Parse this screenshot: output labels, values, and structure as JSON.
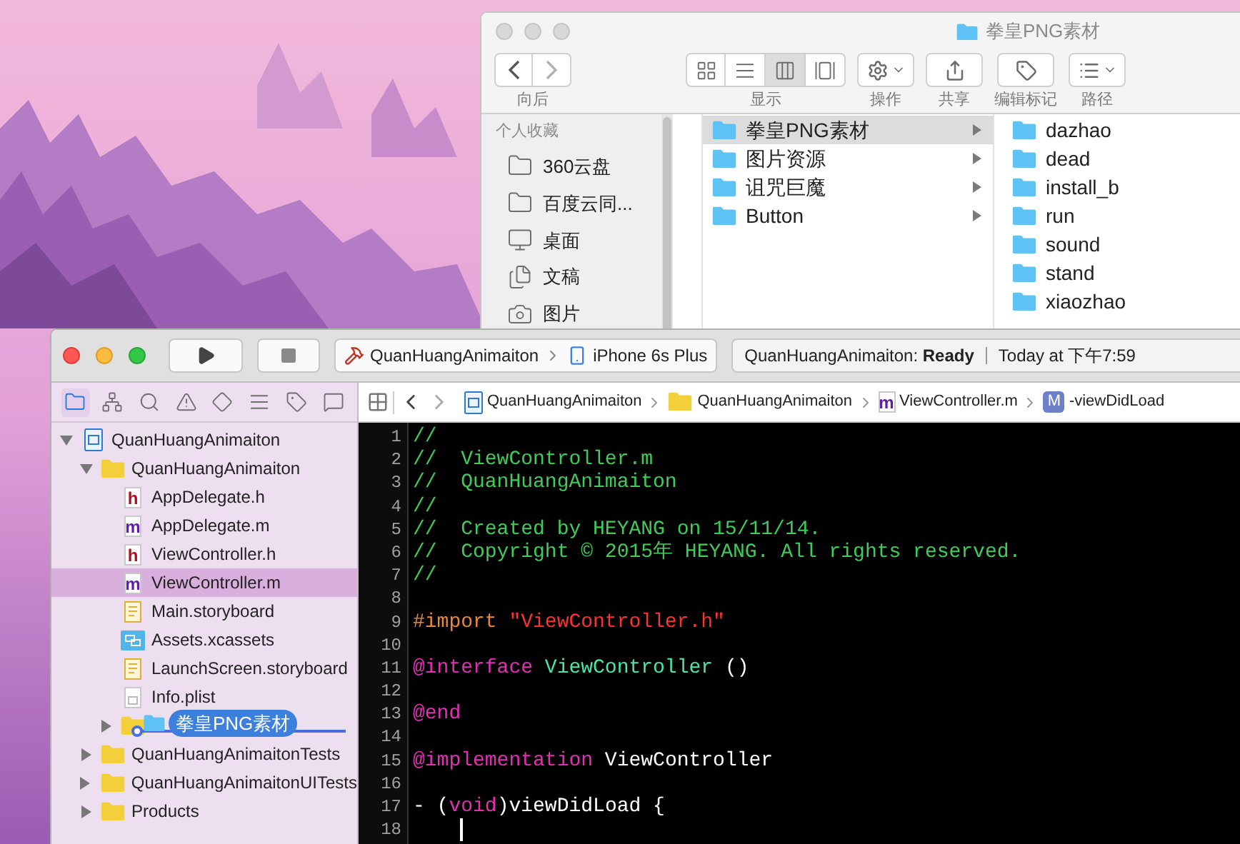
{
  "finder": {
    "title": "拳皇PNG素材",
    "toolbar": [
      {
        "label": "向后",
        "kind": "nav"
      },
      {
        "label": "显示",
        "kind": "view"
      },
      {
        "label": "操作",
        "kind": "action"
      },
      {
        "label": "共享",
        "kind": "share"
      },
      {
        "label": "编辑标记",
        "kind": "tag"
      },
      {
        "label": "路径",
        "kind": "path"
      }
    ],
    "view_modes": [
      {
        "kind": "icons",
        "selected": false
      },
      {
        "kind": "list",
        "selected": false
      },
      {
        "kind": "columns",
        "selected": true
      },
      {
        "kind": "coverflow",
        "selected": false
      }
    ],
    "sidebar": {
      "heading": "个人收藏",
      "items": [
        {
          "label": "360云盘",
          "kind": "folder"
        },
        {
          "label": "百度云同...",
          "kind": "folder"
        },
        {
          "label": "桌面",
          "kind": "desktop"
        },
        {
          "label": "文稿",
          "kind": "document"
        },
        {
          "label": "图片",
          "kind": "camera"
        }
      ]
    },
    "columns": [
      {
        "items": [
          {
            "label": "拳皇PNG素材",
            "selected": true,
            "expandable": true
          },
          {
            "label": "图片资源",
            "selected": false,
            "expandable": true
          },
          {
            "label": "诅咒巨魔",
            "selected": false,
            "expandable": true
          },
          {
            "label": "Button",
            "selected": false,
            "expandable": true
          }
        ]
      },
      {
        "items": [
          {
            "label": "dazhao",
            "selected": false,
            "expandable": false
          },
          {
            "label": "dead",
            "selected": false,
            "expandable": false
          },
          {
            "label": "install_b",
            "selected": false,
            "expandable": false
          },
          {
            "label": "run",
            "selected": false,
            "expandable": false
          },
          {
            "label": "sound",
            "selected": false,
            "expandable": false
          },
          {
            "label": "stand",
            "selected": false,
            "expandable": false
          },
          {
            "label": "xiaozhao",
            "selected": false,
            "expandable": false
          }
        ]
      }
    ]
  },
  "xcode": {
    "scheme": "QuanHuangAnimaiton",
    "device": "iPhone 6s Plus",
    "status": "QuanHuangAnimaiton: **Ready**",
    "time": "Today at 下午7:59",
    "navigator_tabs": [
      {
        "kind": "folder",
        "selected": true
      },
      {
        "kind": "hierarchy",
        "selected": false
      },
      {
        "kind": "search",
        "selected": false
      },
      {
        "kind": "warning",
        "selected": false
      },
      {
        "kind": "test",
        "selected": false
      },
      {
        "kind": "debug",
        "selected": false
      },
      {
        "kind": "breakpoint",
        "selected": false
      },
      {
        "kind": "report",
        "selected": false
      }
    ],
    "jump_bar": [
      {
        "label": "QuanHuangAnimaiton",
        "kind": "project"
      },
      {
        "label": "QuanHuangAnimaiton",
        "kind": "folder"
      },
      {
        "label": "ViewController.m",
        "kind": "source",
        "letter": "m"
      },
      {
        "label": "-viewDidLoad",
        "kind": "method",
        "letter": "M"
      }
    ],
    "tree": [
      {
        "label": "QuanHuangAnimaiton",
        "kind": "project",
        "expanded": true,
        "selected": false,
        "children": [
          {
            "label": "QuanHuangAnimaiton",
            "kind": "folder",
            "expanded": true,
            "selected": false,
            "children": [
              {
                "label": "AppDelegate.h",
                "kind": "header",
                "letter": "h",
                "selected": false
              },
              {
                "label": "AppDelegate.m",
                "kind": "source",
                "letter": "m",
                "selected": false
              },
              {
                "label": "ViewController.h",
                "kind": "header",
                "letter": "h",
                "selected": false
              },
              {
                "label": "ViewController.m",
                "kind": "source",
                "letter": "m",
                "selected": true
              },
              {
                "label": "Main.storyboard",
                "kind": "storyboard",
                "selected": false
              },
              {
                "label": "Assets.xcassets",
                "kind": "assets",
                "selected": false
              },
              {
                "label": "LaunchScreen.storyboard",
                "kind": "storyboard",
                "selected": false
              },
              {
                "label": "Info.plist",
                "kind": "plist",
                "selected": false
              },
              {
                "kind": "folder",
                "expanded": false,
                "selected": false,
                "drag": "拳皇PNG素材"
              }
            ]
          },
          {
            "label": "QuanHuangAnimaitonTests",
            "kind": "folder",
            "expanded": false,
            "selected": false
          },
          {
            "label": "QuanHuangAnimaitonUITests",
            "kind": "folder",
            "expanded": false,
            "selected": false
          },
          {
            "label": "Products",
            "kind": "folder",
            "expanded": false,
            "selected": false
          }
        ]
      }
    ],
    "editor": {
      "lines": [
        {
          "number": "1",
          "tokens": [
            {
              "text": "//",
              "kind": "comment"
            }
          ]
        },
        {
          "number": "2",
          "tokens": [
            {
              "text": "//  ViewController.m",
              "kind": "comment"
            }
          ]
        },
        {
          "number": "3",
          "tokens": [
            {
              "text": "//  QuanHuangAnimaiton",
              "kind": "comment"
            }
          ]
        },
        {
          "number": "4",
          "tokens": [
            {
              "text": "//",
              "kind": "comment"
            }
          ]
        },
        {
          "number": "5",
          "tokens": [
            {
              "text": "//  Created by HEYANG on 15/11/14.",
              "kind": "comment"
            }
          ]
        },
        {
          "number": "6",
          "tokens": [
            {
              "text": "//  Copyright © 2015年 HEYANG. All rights reserved.",
              "kind": "comment"
            }
          ]
        },
        {
          "number": "7",
          "tokens": [
            {
              "text": "//",
              "kind": "comment"
            }
          ]
        },
        {
          "number": "8"
        },
        {
          "number": "9",
          "tokens": [
            {
              "text": "#import ",
              "kind": "preproc"
            },
            {
              "text": "\"ViewController.h\"",
              "kind": "string"
            }
          ]
        },
        {
          "number": "10"
        },
        {
          "number": "11",
          "tokens": [
            {
              "text": "@interface",
              "kind": "keyword"
            },
            {
              "text": " ViewController",
              "kind": "class"
            },
            {
              "text": " ()",
              "kind": "plain"
            }
          ]
        },
        {
          "number": "12"
        },
        {
          "number": "13",
          "tokens": [
            {
              "text": "@end",
              "kind": "keyword"
            }
          ]
        },
        {
          "number": "14"
        },
        {
          "number": "15",
          "tokens": [
            {
              "text": "@implementation",
              "kind": "keyword"
            },
            {
              "text": " ViewController",
              "kind": "plain"
            }
          ]
        },
        {
          "number": "16"
        },
        {
          "number": "17",
          "tokens": [
            {
              "text": "- (",
              "kind": "plain"
            },
            {
              "text": "void",
              "kind": "keyword"
            },
            {
              "text": ")viewDidLoad {",
              "kind": "plain"
            }
          ]
        },
        {
          "number": "18",
          "cursor": true
        }
      ]
    }
  }
}
